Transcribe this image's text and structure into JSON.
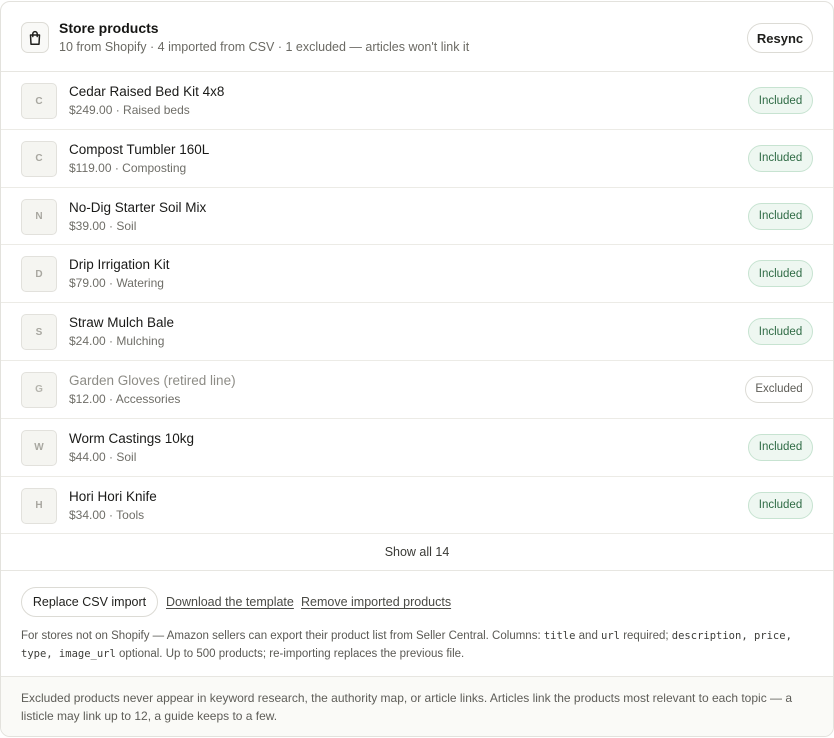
{
  "header": {
    "title": "Store products",
    "subtitle": "10 from Shopify · 4 imported from CSV · 1 excluded — articles won't link it",
    "resync_label": "Resync",
    "icon": "shopping-bag-icon"
  },
  "products": [
    {
      "initial": "C",
      "name": "Cedar Raised Bed Kit 4x8",
      "meta": "$249.00 · Raised beds",
      "status": "Included"
    },
    {
      "initial": "C",
      "name": "Compost Tumbler 160L",
      "meta": "$119.00 · Composting",
      "status": "Included"
    },
    {
      "initial": "N",
      "name": "No-Dig Starter Soil Mix",
      "meta": "$39.00 · Soil",
      "status": "Included"
    },
    {
      "initial": "D",
      "name": "Drip Irrigation Kit",
      "meta": "$79.00 · Watering",
      "status": "Included"
    },
    {
      "initial": "S",
      "name": "Straw Mulch Bale",
      "meta": "$24.00 · Mulching",
      "status": "Included"
    },
    {
      "initial": "G",
      "name": "Garden Gloves (retired line)",
      "meta": "$12.00 · Accessories",
      "status": "Excluded"
    },
    {
      "initial": "W",
      "name": "Worm Castings 10kg",
      "meta": "$44.00 · Soil",
      "status": "Included"
    },
    {
      "initial": "H",
      "name": "Hori Hori Knife",
      "meta": "$34.00 · Tools",
      "status": "Included"
    }
  ],
  "show_all_label": "Show all 14",
  "csv": {
    "replace_label": "Replace CSV import",
    "download_label": "Download the template",
    "remove_label": "Remove imported products",
    "help_intro": "For stores not on Shopify — Amazon sellers can export their product list from Seller Central. Columns: ",
    "col_title": "title",
    "and_word": " and ",
    "col_url": "url",
    "required_text": " required; ",
    "col_optional": "description, price, type, image_url",
    "help_outro": " optional. Up to 500 products; re-importing replaces the previous file."
  },
  "footer_text": "Excluded products never appear in keyword research, the authority map, or article links. Articles link the products most relevant to each topic — a listicle may link up to 12, a guide keeps to a few.",
  "colors": {
    "included_bg": "#eef7f1",
    "included_text": "#2f6b45",
    "excluded_text": "#5e5d57"
  }
}
